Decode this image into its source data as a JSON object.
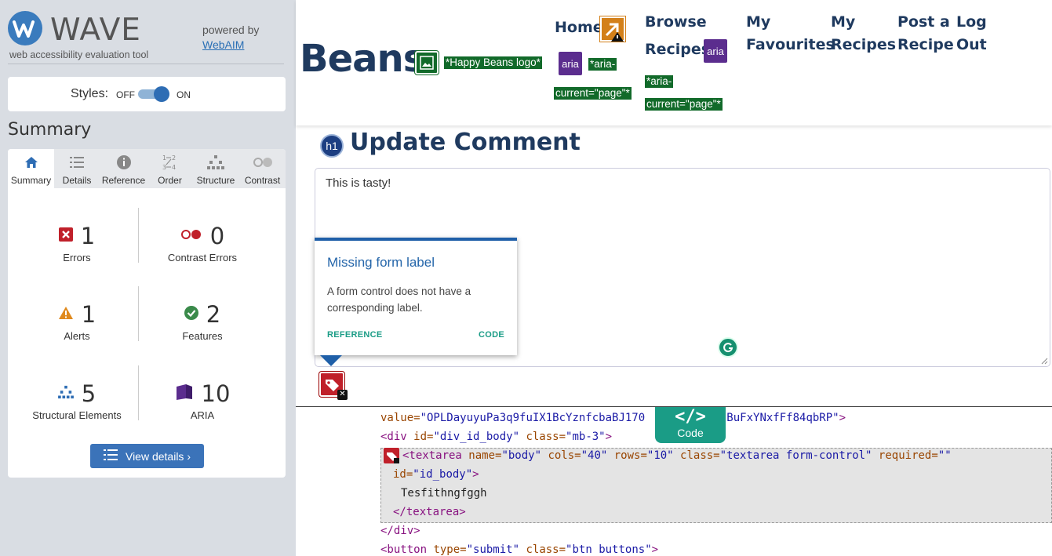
{
  "wave": {
    "title": "WAVE",
    "tagline": "web accessibility evaluation tool",
    "powered_by": "powered by",
    "webaim_link": "WebAIM",
    "styles_label": "Styles:",
    "styles_off": "OFF",
    "styles_on": "ON",
    "summary_heading": "Summary",
    "tabs": [
      {
        "label": "Summary",
        "icon": "home-icon"
      },
      {
        "label": "Details",
        "icon": "list-icon"
      },
      {
        "label": "Reference",
        "icon": "info-icon"
      },
      {
        "label": "Order",
        "icon": "order-icon"
      },
      {
        "label": "Structure",
        "icon": "structure-icon"
      },
      {
        "label": "Contrast",
        "icon": "contrast-icon"
      }
    ],
    "stats": {
      "errors": {
        "count": "1",
        "label": "Errors"
      },
      "contrast_errors": {
        "count": "0",
        "label": "Contrast Errors"
      },
      "alerts": {
        "count": "1",
        "label": "Alerts"
      },
      "features": {
        "count": "2",
        "label": "Features"
      },
      "structural": {
        "count": "5",
        "label": "Structural Elements"
      },
      "aria": {
        "count": "10",
        "label": "ARIA"
      }
    },
    "view_details": "View details ›"
  },
  "site": {
    "logo_text": "Beans",
    "logo_alt": "*Happy Beans logo*",
    "nav": {
      "home": "Home",
      "browse": [
        "Browse",
        "Recipes"
      ],
      "favourites": [
        "My",
        "Favourites"
      ],
      "my_recipes": [
        "My",
        "Recipes"
      ],
      "post": [
        "Post a",
        "Recipe"
      ],
      "logout": [
        "Log",
        "Out"
      ]
    },
    "aria_icon_text": "aria",
    "aria_current_tag": [
      "*aria-",
      "current=\"page\"*"
    ],
    "h1_badge": "h1",
    "page_title": "Update Comment",
    "textarea_value": "This is tasty!"
  },
  "tooltip": {
    "title": "Missing form label",
    "body": "A form control does not have a corresponding label.",
    "reference": "REFERENCE",
    "code": "CODE"
  },
  "code_panel": {
    "tab_icon": "</>",
    "tab_label": "Code",
    "line1": {
      "attr": "value=",
      "val": "\"OPLDayuyuPa3q9fuIX1BcYznfcbaBJ170",
      "val2": "qKi2JBuFxYNxfFf84qbRP\"",
      "end": ">"
    },
    "line2": {
      "open": "<div",
      "a1": " id=",
      "v1": "\"div_id_body\"",
      "a2": " class=",
      "v2": "\"mb-3\"",
      "close": ">"
    },
    "line3": {
      "open": "<textarea",
      "a1": " name=",
      "v1": "\"body\"",
      "a2": " cols=",
      "v2": "\"40\"",
      "a3": " rows=",
      "v3": "\"10\"",
      "a4": " class=",
      "v4": "\"textarea form-control\"",
      "a5": " required=",
      "v5": "\"\""
    },
    "line4": {
      "a1": "id=",
      "v1": "\"id_body\"",
      "close": ">"
    },
    "line5": "Tesfithngfggh",
    "line6": "</textarea>",
    "line7": "</div>",
    "line8": {
      "open": "<button",
      "a1": " type=",
      "v1": "\"submit\"",
      "a2": " class=",
      "v2": "\"btn buttons\"",
      "close": ">"
    }
  },
  "colors": {
    "wave_blue": "#3a7bbd",
    "error_red": "#c0202a",
    "aria_purple": "#5b2d8e",
    "alt_green": "#126a2a",
    "teal": "#1a9c86",
    "navy": "#1f3a5f"
  }
}
